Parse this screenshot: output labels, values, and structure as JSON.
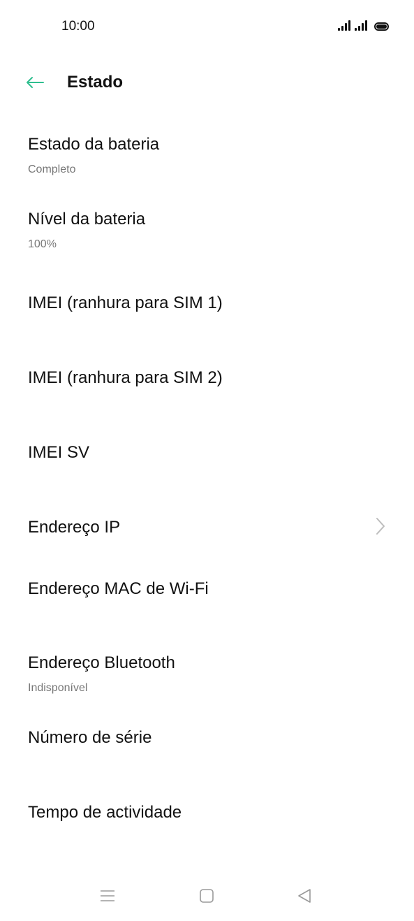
{
  "status_bar": {
    "time": "10:00",
    "battery_level": 1.0,
    "icons": [
      "signal-sim1-icon",
      "signal-sim2-icon",
      "battery-icon"
    ]
  },
  "header": {
    "back_icon": "arrow-left-icon",
    "title": "Estado",
    "accent_color": "#2fbf8f"
  },
  "rows": [
    {
      "title": "Estado da bateria",
      "subtitle": "Completo"
    },
    {
      "title": "Nível da bateria",
      "subtitle": "100%"
    },
    {
      "title": "IMEI (ranhura para SIM 1)",
      "subtitle": ""
    },
    {
      "title": "IMEI (ranhura para SIM 2)",
      "subtitle": ""
    },
    {
      "title": "IMEI SV",
      "subtitle": ""
    },
    {
      "title": "Endereço IP",
      "subtitle": "",
      "chevron_icon": "chevron-right-icon"
    },
    {
      "title": "Endereço MAC de Wi-Fi",
      "subtitle": ""
    },
    {
      "title": "Endereço Bluetooth",
      "subtitle": "Indisponível"
    },
    {
      "title": "Número de série",
      "subtitle": ""
    },
    {
      "title": "Tempo de actividade",
      "subtitle": ""
    }
  ],
  "nav_bar": {
    "icons": [
      "menu-icon",
      "home-icon",
      "back-triangle-icon"
    ]
  }
}
